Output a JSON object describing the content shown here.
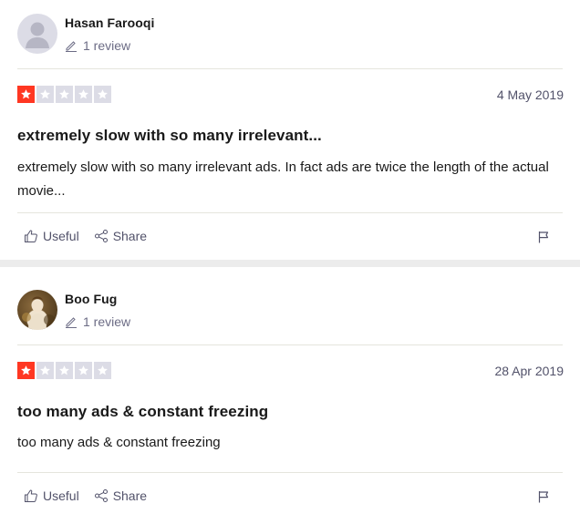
{
  "reviews": [
    {
      "reviewer_name": "Hasan Farooqi",
      "review_count": "1 review",
      "rating": 1,
      "max_rating": 5,
      "date": "4 May 2019",
      "title": "extremely slow with so many irrelevant...",
      "body": "extremely slow with so many irrelevant ads. In fact ads are twice the length of the actual movie...",
      "useful_label": "Useful",
      "share_label": "Share",
      "avatar_icon": "default-user-avatar-icon"
    },
    {
      "reviewer_name": "Boo Fug",
      "review_count": "1 review",
      "rating": 1,
      "max_rating": 5,
      "date": "28 Apr 2019",
      "title": "too many ads & constant freezing",
      "body": "too many ads & constant freezing",
      "useful_label": "Useful",
      "share_label": "Share",
      "avatar_icon": "user-photo-avatar"
    }
  ],
  "colors": {
    "star_filled": "#ff3722",
    "star_empty": "#dcdce6",
    "separator": "#ececec",
    "muted_text": "#6c6c85"
  }
}
